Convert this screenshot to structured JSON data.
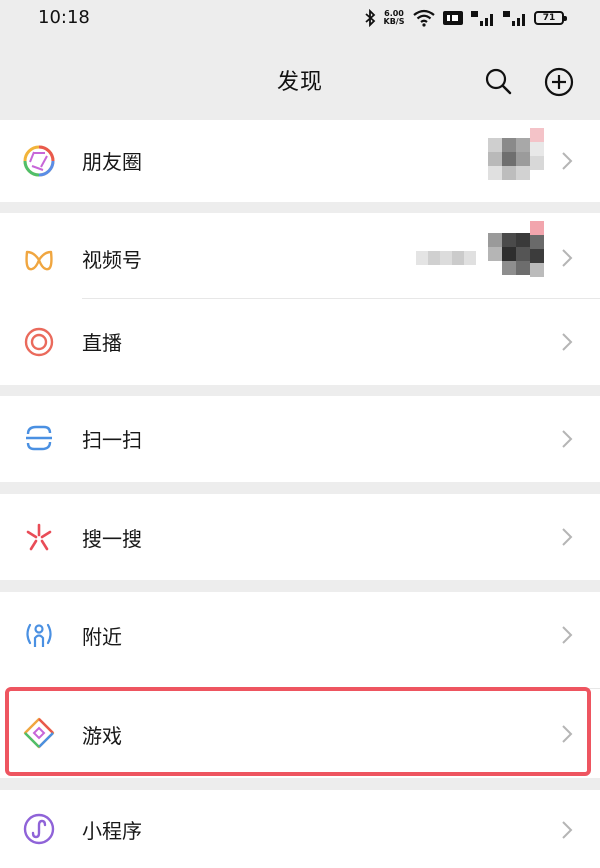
{
  "status_bar": {
    "time": "10:18",
    "net_speed_value": "6.00",
    "net_speed_unit": "KB/S",
    "battery_level": "71"
  },
  "nav": {
    "title": "发现",
    "search_icon": "search-icon",
    "add_icon": "plus-circle-icon"
  },
  "items": [
    {
      "label": "朋友圈",
      "icon": "moments-aperture-icon"
    },
    {
      "label": "视频号",
      "icon": "channels-icon"
    },
    {
      "label": "直播",
      "icon": "live-icon"
    },
    {
      "label": "扫一扫",
      "icon": "scan-icon"
    },
    {
      "label": "搜一搜",
      "icon": "search-spark-icon"
    },
    {
      "label": "附近",
      "icon": "nearby-icon"
    },
    {
      "label": "游戏",
      "icon": "games-diamond-icon"
    },
    {
      "label": "小程序",
      "icon": "mini-programs-icon"
    }
  ],
  "colors": {
    "background": "#ededed",
    "highlight": "#ee5560"
  }
}
